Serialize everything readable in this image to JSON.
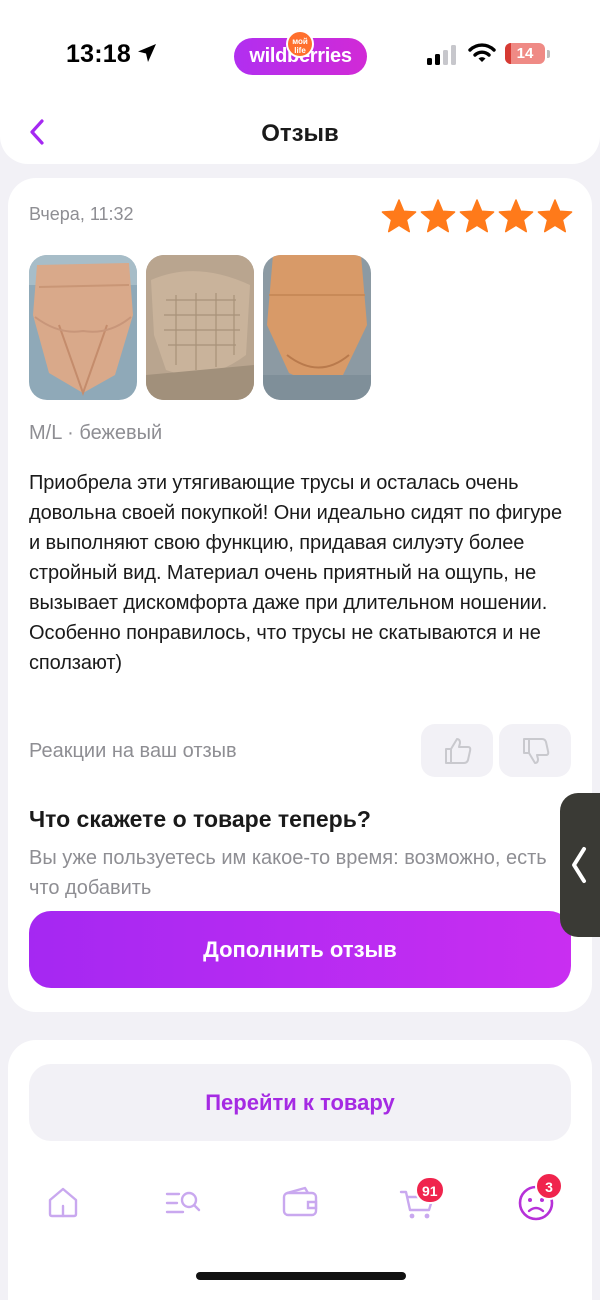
{
  "status_bar": {
    "time": "13:18",
    "brand": "wildberries",
    "brand_badge": "мой life",
    "battery": "14",
    "battery_level": 0.14,
    "icons": [
      "location-arrow-icon",
      "cellular-signal-icon",
      "wifi-icon",
      "battery-icon"
    ]
  },
  "header": {
    "title": "Отзыв",
    "back_icon": "chevron-left-icon"
  },
  "review": {
    "date": "Вчера, 11:32",
    "rating": 5,
    "rating_max": 5,
    "photos": [
      {
        "description": "photo-1"
      },
      {
        "description": "photo-2"
      },
      {
        "description": "photo-3"
      }
    ],
    "variant": "M/L · бежевый",
    "text": "Приобрела эти утягивающие трусы и осталась очень довольна своей покупкой! Они идеально сидят по фигуре и выполняют свою функцию, придавая силуэту более стройный вид. Материал очень приятный на ощупь, не вызывает дискомфорта даже при длительном ношении. Особенно понравилось, что трусы не скатываются и не сползают)",
    "reactions_label": "Реакции на ваш отзыв",
    "prompt_title": "Что скажете о товаре теперь?",
    "prompt_subtitle": "Вы уже пользуетесь им какое-то время: возможно, есть что добавить",
    "add_button": "Дополнить отзыв"
  },
  "product": {
    "goto_button": "Перейти к товару"
  },
  "tab_bar": {
    "items": [
      {
        "name": "home",
        "icon": "home-icon"
      },
      {
        "name": "catalog",
        "icon": "search-list-icon"
      },
      {
        "name": "wallet",
        "icon": "wallet-icon"
      },
      {
        "name": "cart",
        "icon": "cart-icon",
        "badge": "91"
      },
      {
        "name": "profile",
        "icon": "profile-icon",
        "badge": "3"
      }
    ]
  },
  "colors": {
    "accent": "#a528f2",
    "star": "#ff7a1a",
    "badge": "#f0244d",
    "muted_text": "#8e8e93"
  }
}
